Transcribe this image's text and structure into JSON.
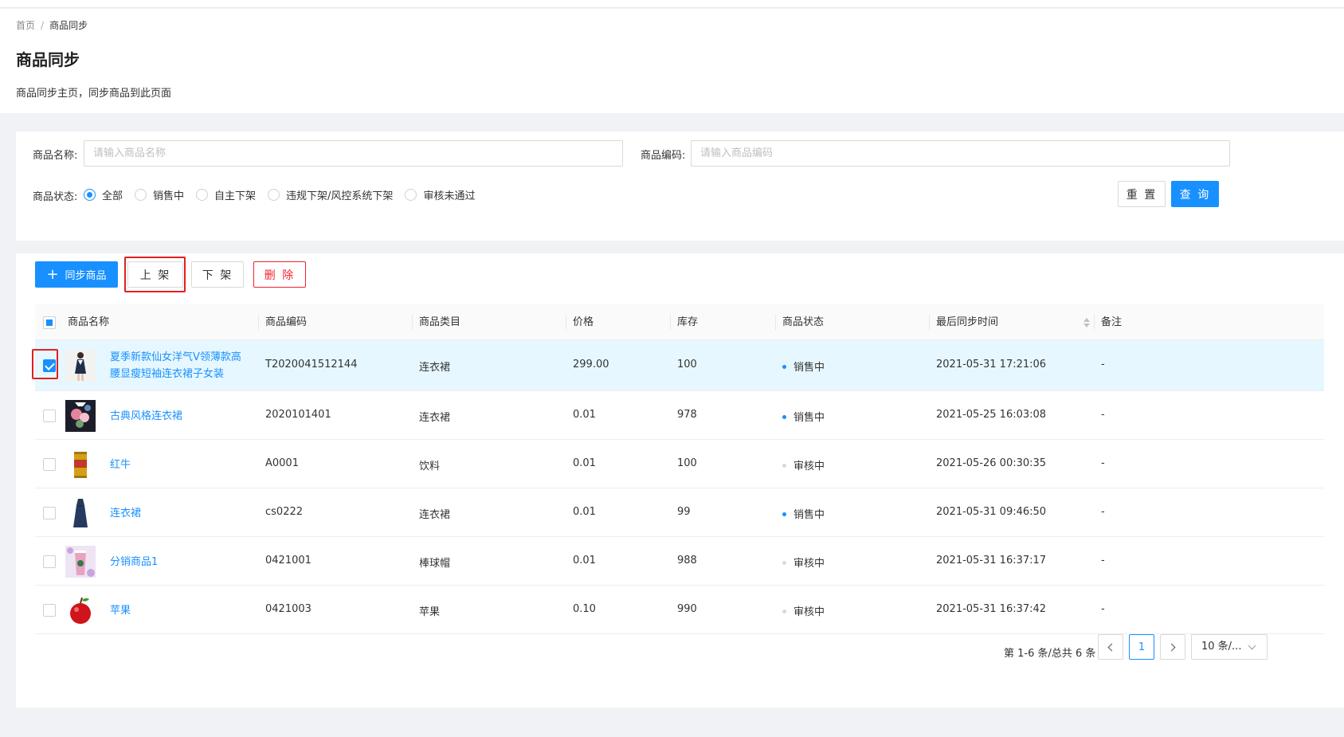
{
  "breadcrumb": {
    "home": "首页",
    "separator": "/",
    "current": "商品同步"
  },
  "page": {
    "title": "商品同步",
    "description": "商品同步主页，同步商品到此页面"
  },
  "filter": {
    "name_label": "商品名称:",
    "name_placeholder": "请输入商品名称",
    "code_label": "商品编码:",
    "code_placeholder": "请输入商品编码",
    "status_label": "商品状态:",
    "status_options": [
      "全部",
      "销售中",
      "自主下架",
      "违规下架/风控系统下架",
      "审核未通过"
    ],
    "status_selected": "全部",
    "reset_label": "重 置",
    "query_label": "查 询"
  },
  "toolbar": {
    "sync_label": "同步商品",
    "list_label": "上 架",
    "delist_label": "下 架",
    "delete_label": "删 除"
  },
  "table": {
    "columns": [
      "商品名称",
      "商品编码",
      "商品类目",
      "价格",
      "库存",
      "商品状态",
      "最后同步时间",
      "备注"
    ],
    "rows": [
      {
        "checked": true,
        "thumb": "dress-model-thumbnail",
        "name_line1": "夏季新款仙女洋气V领薄款高",
        "name_line2": "腰显瘦短袖连衣裙子女装",
        "code": "T2020041512144",
        "category": "连衣裙",
        "price": "299.00",
        "stock": "100",
        "status": "销售中",
        "status_color": "#1890ff",
        "sync_time": "2021-05-31 17:21:06",
        "note": "-"
      },
      {
        "checked": false,
        "thumb": "floral-dress-thumbnail",
        "name_line1": "古典风格连衣裙",
        "name_line2": "",
        "code": "2020101401",
        "category": "连衣裙",
        "price": "0.01",
        "stock": "978",
        "status": "销售中",
        "status_color": "#1890ff",
        "sync_time": "2021-05-25 16:03:08",
        "note": "-"
      },
      {
        "checked": false,
        "thumb": "red-bull-can-thumbnail",
        "name_line1": "红牛",
        "name_line2": "",
        "code": "A0001",
        "category": "饮料",
        "price": "0.01",
        "stock": "100",
        "status": "审核中",
        "status_color": "#d9d9d9",
        "sync_time": "2021-05-26 00:30:35",
        "note": "-"
      },
      {
        "checked": false,
        "thumb": "navy-dress-thumbnail",
        "name_line1": "连衣裙",
        "name_line2": "",
        "code": "cs0222",
        "category": "连衣裙",
        "price": "0.01",
        "stock": "99",
        "status": "销售中",
        "status_color": "#1890ff",
        "sync_time": "2021-05-31 09:46:50",
        "note": "-"
      },
      {
        "checked": false,
        "thumb": "drink-cup-thumbnail",
        "name_line1": "分销商品1",
        "name_line2": "",
        "code": "0421001",
        "category": "棒球帽",
        "price": "0.01",
        "stock": "988",
        "status": "审核中",
        "status_color": "#d9d9d9",
        "sync_time": "2021-05-31 16:37:17",
        "note": "-"
      },
      {
        "checked": false,
        "thumb": "apple-thumbnail",
        "name_line1": "苹果",
        "name_line2": "",
        "code": "0421003",
        "category": "苹果",
        "price": "0.10",
        "stock": "990",
        "status": "审核中",
        "status_color": "#d9d9d9",
        "sync_time": "2021-05-31 16:37:42",
        "note": "-"
      }
    ]
  },
  "pagination": {
    "total_text": "第 1-6 条/总共 6 条",
    "current_page": "1",
    "page_size": "10 条/..."
  },
  "colors": {
    "primary": "#1890ff",
    "danger": "#f5222d",
    "highlight": "#e02020",
    "selected_row": "#e6f7ff"
  }
}
